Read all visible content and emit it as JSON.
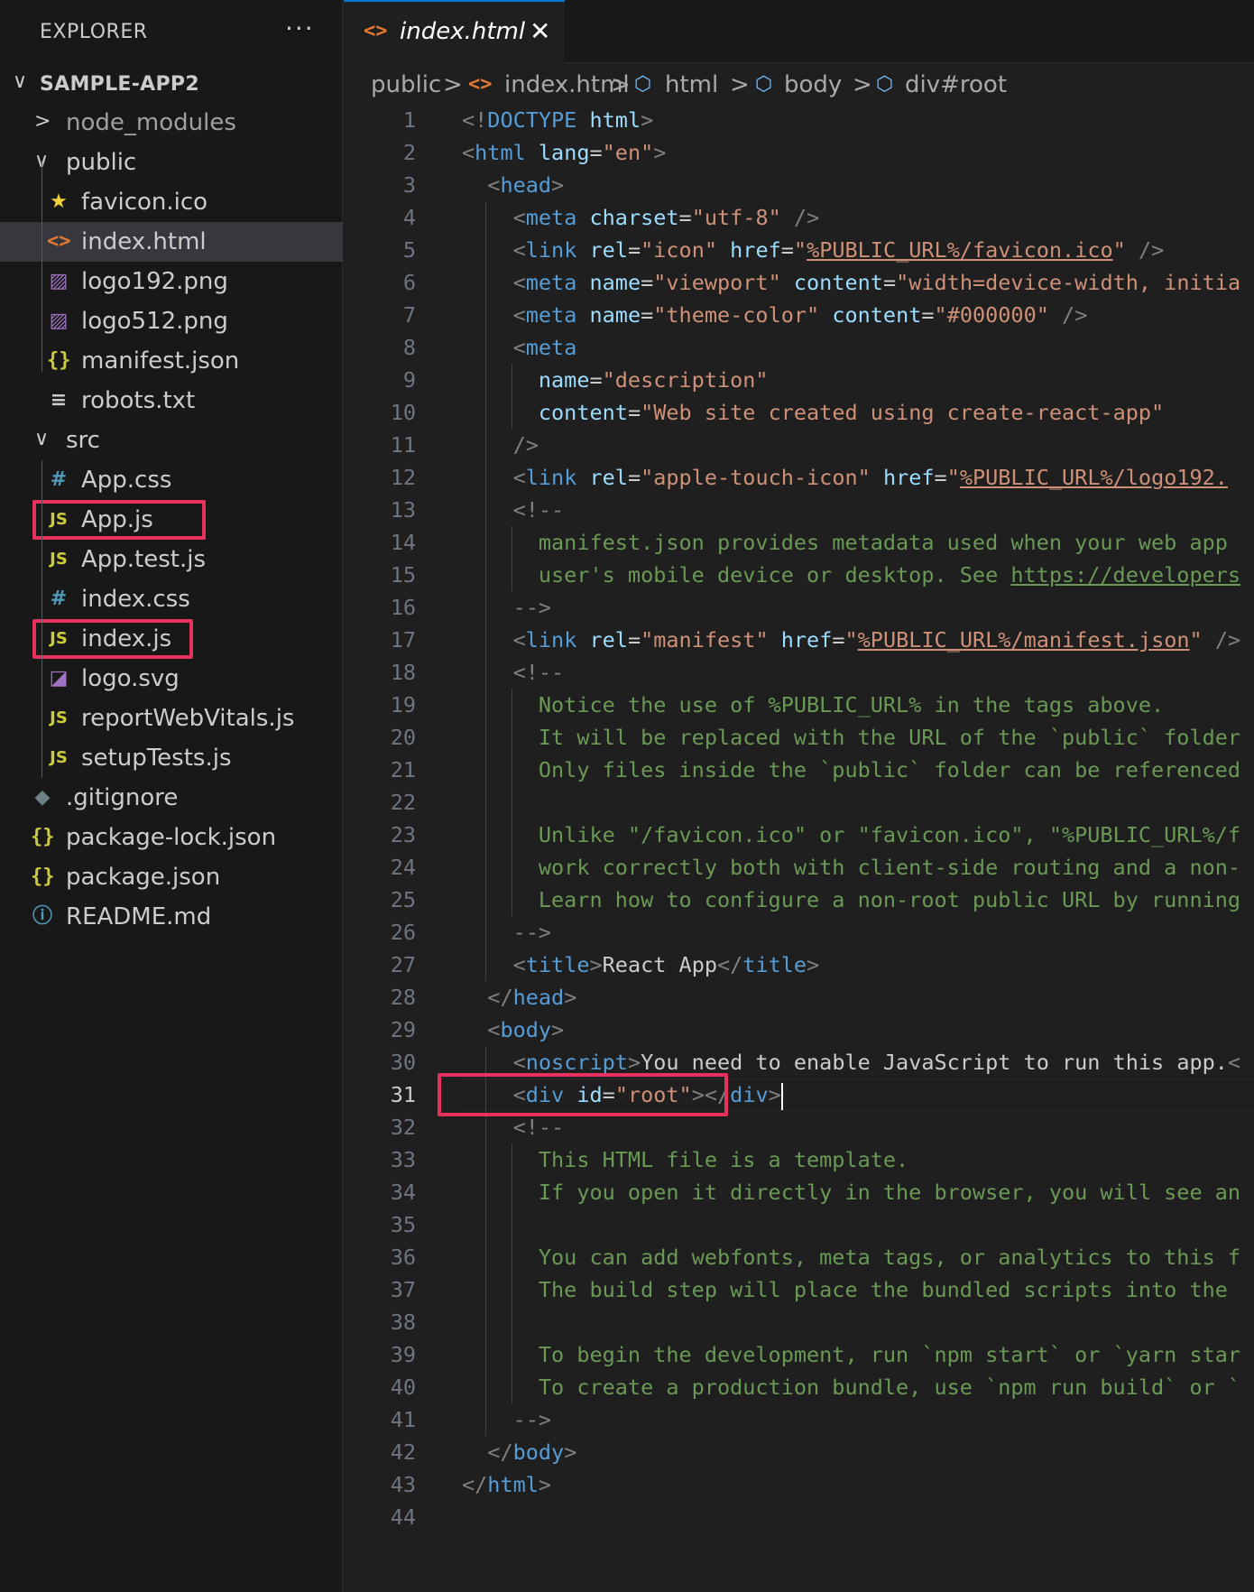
{
  "sidebar": {
    "title": "EXPLORER",
    "more": "···",
    "items": [
      {
        "label": "SAMPLE-APP2",
        "kind": "root",
        "chev": "∨",
        "icon": ""
      },
      {
        "label": "node_modules",
        "kind": "folder",
        "chev": ">",
        "icon": ""
      },
      {
        "label": "public",
        "kind": "folder",
        "chev": "∨",
        "icon": ""
      },
      {
        "label": "favicon.ico",
        "kind": "file",
        "icon": "star-icon"
      },
      {
        "label": "index.html",
        "kind": "file",
        "icon": "html-icon"
      },
      {
        "label": "logo192.png",
        "kind": "file",
        "icon": "image-icon"
      },
      {
        "label": "logo512.png",
        "kind": "file",
        "icon": "image-icon"
      },
      {
        "label": "manifest.json",
        "kind": "file",
        "icon": "json-icon"
      },
      {
        "label": "robots.txt",
        "kind": "file",
        "icon": "text-icon"
      },
      {
        "label": "src",
        "kind": "folder",
        "chev": "∨",
        "icon": ""
      },
      {
        "label": "App.css",
        "kind": "file",
        "icon": "css-icon"
      },
      {
        "label": "App.js",
        "kind": "file",
        "icon": "js-icon"
      },
      {
        "label": "App.test.js",
        "kind": "file",
        "icon": "js-icon"
      },
      {
        "label": "index.css",
        "kind": "file",
        "icon": "css-icon"
      },
      {
        "label": "index.js",
        "kind": "file",
        "icon": "js-icon"
      },
      {
        "label": "logo.svg",
        "kind": "file",
        "icon": "svg-icon"
      },
      {
        "label": "reportWebVitals.js",
        "kind": "file",
        "icon": "js-icon"
      },
      {
        "label": "setupTests.js",
        "kind": "file",
        "icon": "js-icon"
      },
      {
        "label": ".gitignore",
        "kind": "file",
        "icon": "git-icon"
      },
      {
        "label": "package-lock.json",
        "kind": "file",
        "icon": "json-icon"
      },
      {
        "label": "package.json",
        "kind": "file",
        "icon": "json-icon"
      },
      {
        "label": "README.md",
        "kind": "file",
        "icon": "info-icon"
      }
    ],
    "selected_item": "index.html",
    "highlighted_items": [
      "App.js",
      "index.js"
    ]
  },
  "tabs": [
    {
      "label": "index.html",
      "icon": "html-icon",
      "close": "✕",
      "active": true
    }
  ],
  "breadcrumb": {
    "items": [
      "public",
      "index.html",
      "html",
      "body",
      "div#root"
    ],
    "separator": ">"
  },
  "editor": {
    "active_line": 31,
    "highlighted_line": 31,
    "lines": [
      "<!DOCTYPE html>",
      "<html lang=\"en\">",
      "  <head>",
      "    <meta charset=\"utf-8\" />",
      "    <link rel=\"icon\" href=\"%PUBLIC_URL%/favicon.ico\" />",
      "    <meta name=\"viewport\" content=\"width=device-width, initia",
      "    <meta name=\"theme-color\" content=\"#000000\" />",
      "    <meta",
      "      name=\"description\"",
      "      content=\"Web site created using create-react-app\"",
      "    />",
      "    <link rel=\"apple-touch-icon\" href=\"%PUBLIC_URL%/logo192.p",
      "    <!--",
      "      manifest.json provides metadata used when your web app",
      "      user's mobile device or desktop. See https://developers",
      "    -->",
      "    <link rel=\"manifest\" href=\"%PUBLIC_URL%/manifest.json\" />",
      "    <!--",
      "      Notice the use of %PUBLIC_URL% in the tags above.",
      "      It will be replaced with the URL of the `public` folder",
      "      Only files inside the `public` folder can be referenced",
      "",
      "      Unlike \"/favicon.ico\" or \"favicon.ico\", \"%PUBLIC_URL%/f",
      "      work correctly both with client-side routing and a non-",
      "      Learn how to configure a non-root public URL by running",
      "    -->",
      "    <title>React App</title>",
      "  </head>",
      "  <body>",
      "    <noscript>You need to enable JavaScript to run this app.<",
      "    <div id=\"root\"></div>",
      "    <!--",
      "      This HTML file is a template.",
      "      If you open it directly in the browser, you will see an",
      "",
      "      You can add webfonts, meta tags, or analytics to this f",
      "      The build step will place the bundled scripts into the",
      "",
      "      To begin the development, run `npm start` or `yarn star",
      "      To create a production bundle, use `npm run build` or `",
      "    -->",
      "  </body>",
      "</html>",
      ""
    ]
  },
  "colors": {
    "tag": "#569cd6",
    "attribute": "#9cdcfe",
    "string": "#ce9178",
    "comment": "#6a9955",
    "punctuation": "#808080",
    "highlight_box": "#e8325e",
    "tab_accent": "#0078d4"
  }
}
